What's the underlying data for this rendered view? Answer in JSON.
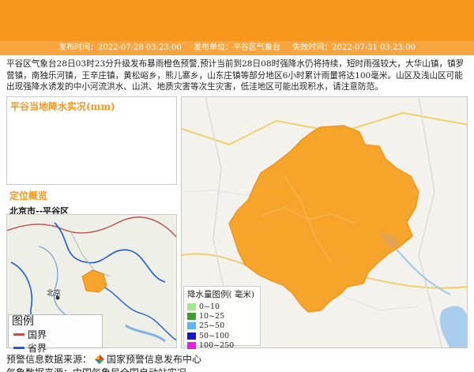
{
  "header": {
    "issue_time": "发布时间：2022-07-28 03:23:00",
    "issuer": "发布单位：平谷区气象台",
    "expire_time": "失效时间：2022-07-31 03:23:00"
  },
  "description": "平谷区气象台28日03时23分升级发布暴雨橙色预警,预计当前到28日08时强降水仍将持续，短时雨强较大，大华山镇，镇罗营镇，南独乐河镇，王辛庄镇，黄松峪乡，熊儿寨乡，山东庄镇等部分地区6小时累计雨量将达100毫米。山区及浅山区可能出现强降水诱发的中小河流洪水、山洪、地质灾害等次生灾害，低洼地区可能出现积水，请注意防范。",
  "rain_panel": {
    "title": "平谷当地降水实况(mm)"
  },
  "location_panel": {
    "title": "定位概览",
    "subtitle": "北京市--平谷区",
    "map_label": "北京"
  },
  "mini_legend": {
    "title": "图例",
    "items": [
      {
        "label": "国界",
        "color": "#c0504d"
      },
      {
        "label": "省界",
        "color": "#1f5bd8"
      }
    ]
  },
  "rain_legend": {
    "title": "降水量图例( 毫米)",
    "items": [
      {
        "label": "0~10",
        "color": "#a8e68c"
      },
      {
        "label": "10~25",
        "color": "#3a9b2e"
      },
      {
        "label": "25~50",
        "color": "#5fb3f0"
      },
      {
        "label": "50~100",
        "color": "#1414d2"
      },
      {
        "label": "100~250",
        "color": "#ee1ce8"
      }
    ]
  },
  "footer": {
    "source_label": "预警信息数据来源：",
    "source_name": "国家预警信息发布中心",
    "data_source": "气象数据来源：中国气象局全国自动站实况"
  },
  "colors": {
    "banner": "#f7971c",
    "warning_area": "#f7a42b"
  }
}
